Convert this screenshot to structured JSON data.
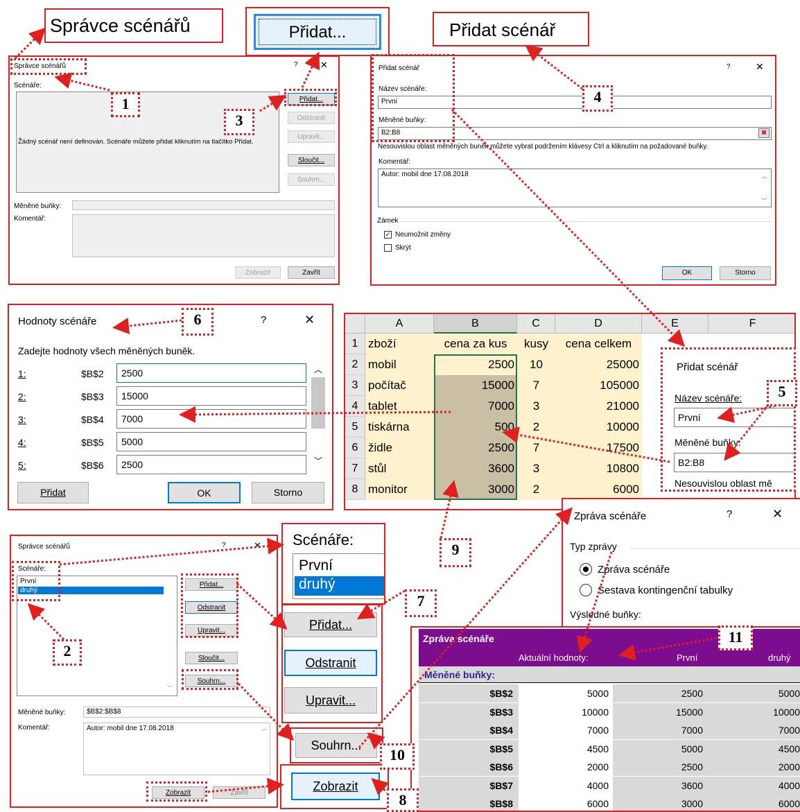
{
  "callouts": {
    "n1": "1",
    "n2": "2",
    "n3": "3",
    "n4": "4",
    "n5": "5",
    "n6": "6",
    "n7": "7",
    "n8": "8",
    "n9": "9",
    "n10": "10",
    "n11": "11"
  },
  "zoom": {
    "spravce_title": "Správce scénářů",
    "pridat": "Přidat...",
    "pridat_scenar": "Přidat scénář",
    "scenare_label": "Scénáře:",
    "scenare_items": [
      "První",
      "druhý"
    ],
    "buttons_pridat": "Přidat...",
    "buttons_odstranit": "Odstranit",
    "buttons_upravit": "Upravit...",
    "souhrn": "Souhrn...",
    "zobrazit": "Zobrazit"
  },
  "manager1": {
    "title": "Správce scénářů",
    "help": "?",
    "close": "✕",
    "scenarios_label": "Scénáře:",
    "empty_msg": "Žádný scénář není definován. Scénáře můžete přidat kliknutím na tlačítko Přidat.",
    "btn_add": "Přidat...",
    "btn_delete": "Odstranit",
    "btn_edit": "Upravit...",
    "btn_merge": "Sloučit...",
    "btn_summary": "Souhrn...",
    "changing_label": "Měněné buňky:",
    "comment_label": "Komentář:",
    "btn_show": "Zobrazit",
    "btn_close": "Zavřít"
  },
  "add_dialog": {
    "title": "Přidat scénář",
    "help": "?",
    "close": "✕",
    "name_label": "Název scénáře:",
    "name_value": "První",
    "changing_label": "Měněné buňky:",
    "changing_value": "B2:B8",
    "hint": "Nesouvislou oblast měněných buněk můžete vybrat podržením klávesy Ctrl a kliknutím na požadované buňky.",
    "comment_label": "Komentář:",
    "comment_value": "Autor: mobil dne 17.08.2018",
    "lock_label": "Zámek",
    "chk_prevent": "Neumožnit změny",
    "chk_hide": "Skrýt",
    "btn_ok": "OK",
    "btn_cancel": "Storno"
  },
  "values_dialog": {
    "title": "Hodnoty scénáře",
    "help": "?",
    "close": "✕",
    "instruction": "Zadejte hodnoty všech měněných buněk.",
    "rows": [
      {
        "idx": "1:",
        "ref": "$B$2",
        "val": "2500"
      },
      {
        "idx": "2:",
        "ref": "$B$3",
        "val": "15000"
      },
      {
        "idx": "3:",
        "ref": "$B$4",
        "val": "7000"
      },
      {
        "idx": "4:",
        "ref": "$B$5",
        "val": "5000"
      },
      {
        "idx": "5:",
        "ref": "$B$6",
        "val": "2500"
      }
    ],
    "btn_add": "Přidat",
    "btn_ok": "OK",
    "btn_cancel": "Storno"
  },
  "sheet": {
    "cols": [
      "A",
      "B",
      "C",
      "D",
      "E",
      "F"
    ],
    "header": [
      "zboží",
      "cena za kus",
      "kusy",
      "cena celkem"
    ],
    "rows": [
      [
        "mobil",
        "2500",
        "10",
        "25000"
      ],
      [
        "počítač",
        "15000",
        "7",
        "105000"
      ],
      [
        "tablet",
        "7000",
        "3",
        "21000"
      ],
      [
        "tiskárna",
        "500",
        "2",
        "10000"
      ],
      [
        "židle",
        "2500",
        "7",
        "17500"
      ],
      [
        "stůl",
        "3600",
        "3",
        "10800"
      ],
      [
        "monitor",
        "3000",
        "2",
        "6000"
      ]
    ],
    "rownums": [
      "1",
      "2",
      "3",
      "4",
      "5",
      "6",
      "7",
      "8"
    ]
  },
  "add_zoom": {
    "title": "Přidat scénář",
    "name_label": "Název scénáře:",
    "name_value": "První",
    "changing_label": "Měněné buňky:",
    "changing_value": "B2:B8",
    "hint": "Nesouvislou oblast mě"
  },
  "manager2": {
    "title": "Správce scénářů",
    "help": "?",
    "close": "✕",
    "scenarios_label": "Scénáře:",
    "items": [
      "První",
      "druhý"
    ],
    "btn_add": "Přidat...",
    "btn_delete": "Odstranit",
    "btn_edit": "Upravit...",
    "btn_merge": "Sloučit...",
    "btn_summary": "Souhrn...",
    "changing_label": "Měněné buňky:",
    "changing_value": "$B$2:$B$8",
    "comment_label": "Komentář:",
    "comment_value": "Autor: mobil dne 17.08.2018",
    "btn_show": "Zobrazit",
    "btn_close": "Zavřít"
  },
  "report_dialog": {
    "title": "Zpráva scénáře",
    "help": "?",
    "close": "✕",
    "type_label": "Typ zprávy",
    "opt1": "Zpráva scénáře",
    "opt2": "Sestava kontingenční tabulky",
    "result_label": "Výsledné buňky:"
  },
  "report": {
    "title": "Zpráva scénáře",
    "col_current": "Aktuální hodnoty:",
    "col_s1": "První",
    "col_s2": "druhý",
    "section": "Měněné buňky:",
    "rows": [
      {
        "ref": "$B$2",
        "cur": "5000",
        "s1": "2500",
        "s2": "5000"
      },
      {
        "ref": "$B$3",
        "cur": "10000",
        "s1": "15000",
        "s2": "10000"
      },
      {
        "ref": "$B$4",
        "cur": "7000",
        "s1": "7000",
        "s2": "7000"
      },
      {
        "ref": "$B$5",
        "cur": "4500",
        "s1": "5000",
        "s2": "4500"
      },
      {
        "ref": "$B$6",
        "cur": "2000",
        "s1": "2500",
        "s2": "2000"
      },
      {
        "ref": "$B$7",
        "cur": "4000",
        "s1": "3600",
        "s2": "4000"
      },
      {
        "ref": "$B$8",
        "cur": "6000",
        "s1": "3000",
        "s2": "6000"
      }
    ]
  },
  "colors": {
    "accent": "#e0201e",
    "selection": "#0078d7",
    "report_header": "#7b0d8e",
    "sheet_bg": "#fff2cc",
    "col_b": "#c9bfa5"
  }
}
